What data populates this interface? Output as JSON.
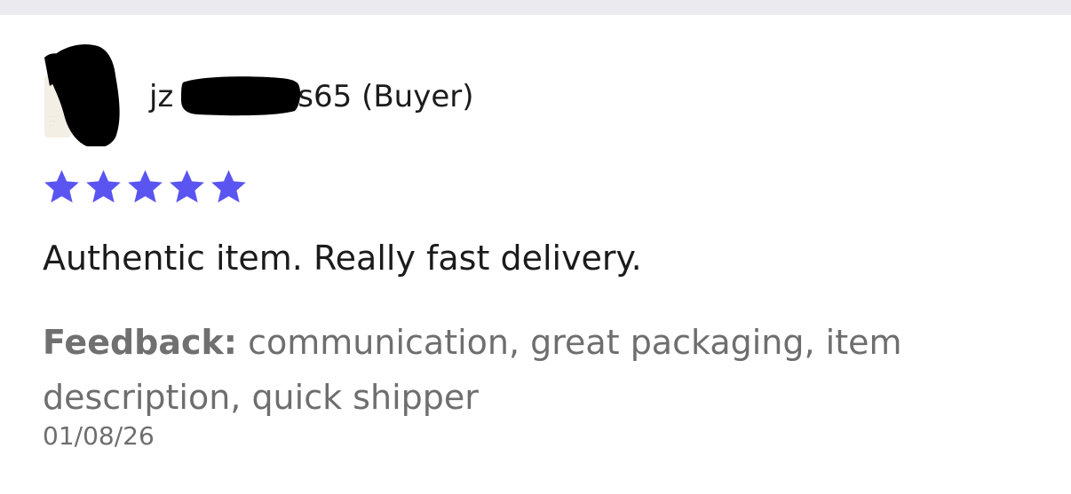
{
  "review": {
    "username_prefix": "jz",
    "username_suffix": "s65 (Buyer)",
    "rating": 5,
    "rating_max": 5,
    "star_color": "#5a55f0",
    "text": "Authentic item. Really fast delivery.",
    "feedback_label": "Feedback:",
    "feedback_value": "communication, great packaging, item description, quick shipper",
    "date": "01/08/26"
  },
  "avatar": {
    "icon": "user-avatar-icon"
  }
}
